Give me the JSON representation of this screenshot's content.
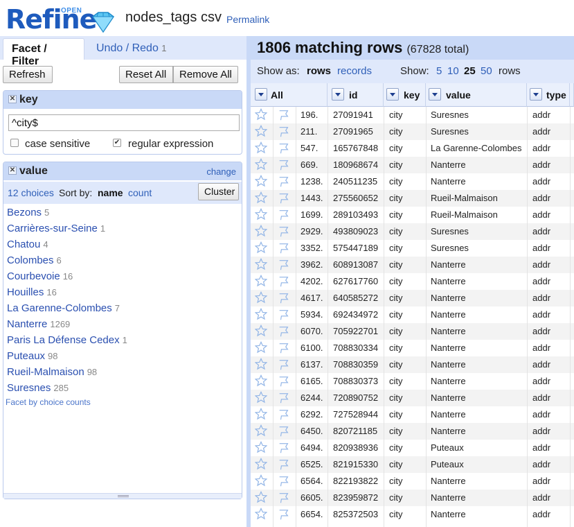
{
  "header": {
    "logo_text": "Refine",
    "logo_badge": "OPEN",
    "project_name": "nodes_tags csv",
    "permalink": "Permalink"
  },
  "left": {
    "tabs": {
      "facet_filter": "Facet / Filter",
      "undo_redo": "Undo / Redo",
      "undo_count": "1"
    },
    "buttons": {
      "refresh": "Refresh",
      "reset_all": "Reset All",
      "remove_all": "Remove All"
    },
    "key_facet": {
      "title": "key",
      "query": "^city$",
      "case_sensitive_label": "case sensitive",
      "case_sensitive": false,
      "regex_label": "regular expression",
      "regex": true
    },
    "value_facet": {
      "title": "value",
      "change": "change",
      "choices_count": "12 choices",
      "sort_by_label": "Sort by:",
      "sort_name": "name",
      "sort_count": "count",
      "cluster": "Cluster",
      "choices": [
        {
          "label": "Bezons",
          "count": "5"
        },
        {
          "label": "Carrières-sur-Seine",
          "count": "1"
        },
        {
          "label": "Chatou",
          "count": "4"
        },
        {
          "label": "Colombes",
          "count": "6"
        },
        {
          "label": "Courbevoie",
          "count": "16"
        },
        {
          "label": "Houilles",
          "count": "16"
        },
        {
          "label": "La Garenne-Colombes",
          "count": "7"
        },
        {
          "label": "Nanterre",
          "count": "1269"
        },
        {
          "label": "Paris La Défense Cedex",
          "count": "1"
        },
        {
          "label": "Puteaux",
          "count": "98"
        },
        {
          "label": "Rueil-Malmaison",
          "count": "98"
        },
        {
          "label": "Suresnes",
          "count": "285"
        }
      ],
      "facet_by_counts": "Facet by choice counts"
    }
  },
  "right": {
    "matching": "1806 matching rows",
    "total": "(67828 total)",
    "show_as_label": "Show as:",
    "show_rows": "rows",
    "show_records": "records",
    "show_label": "Show:",
    "page_sizes": [
      "5",
      "10",
      "25",
      "50"
    ],
    "page_size_selected": "25",
    "rows_word": "rows",
    "columns": [
      "All",
      "id",
      "key",
      "value",
      "type"
    ],
    "rows": [
      {
        "num": "196.",
        "id": "27091941",
        "key": "city",
        "value": "Suresnes",
        "type": "addr"
      },
      {
        "num": "211.",
        "id": "27091965",
        "key": "city",
        "value": "Suresnes",
        "type": "addr"
      },
      {
        "num": "547.",
        "id": "165767848",
        "key": "city",
        "value": "La Garenne-Colombes",
        "type": "addr"
      },
      {
        "num": "669.",
        "id": "180968674",
        "key": "city",
        "value": "Nanterre",
        "type": "addr"
      },
      {
        "num": "1238.",
        "id": "240511235",
        "key": "city",
        "value": "Nanterre",
        "type": "addr"
      },
      {
        "num": "1443.",
        "id": "275560652",
        "key": "city",
        "value": "Rueil-Malmaison",
        "type": "addr"
      },
      {
        "num": "1699.",
        "id": "289103493",
        "key": "city",
        "value": "Rueil-Malmaison",
        "type": "addr"
      },
      {
        "num": "2929.",
        "id": "493809023",
        "key": "city",
        "value": "Suresnes",
        "type": "addr"
      },
      {
        "num": "3352.",
        "id": "575447189",
        "key": "city",
        "value": "Suresnes",
        "type": "addr"
      },
      {
        "num": "3962.",
        "id": "608913087",
        "key": "city",
        "value": "Nanterre",
        "type": "addr"
      },
      {
        "num": "4202.",
        "id": "627617760",
        "key": "city",
        "value": "Nanterre",
        "type": "addr"
      },
      {
        "num": "4617.",
        "id": "640585272",
        "key": "city",
        "value": "Nanterre",
        "type": "addr"
      },
      {
        "num": "5934.",
        "id": "692434972",
        "key": "city",
        "value": "Nanterre",
        "type": "addr"
      },
      {
        "num": "6070.",
        "id": "705922701",
        "key": "city",
        "value": "Nanterre",
        "type": "addr"
      },
      {
        "num": "6100.",
        "id": "708830334",
        "key": "city",
        "value": "Nanterre",
        "type": "addr"
      },
      {
        "num": "6137.",
        "id": "708830359",
        "key": "city",
        "value": "Nanterre",
        "type": "addr"
      },
      {
        "num": "6165.",
        "id": "708830373",
        "key": "city",
        "value": "Nanterre",
        "type": "addr"
      },
      {
        "num": "6244.",
        "id": "720890752",
        "key": "city",
        "value": "Nanterre",
        "type": "addr"
      },
      {
        "num": "6292.",
        "id": "727528944",
        "key": "city",
        "value": "Nanterre",
        "type": "addr"
      },
      {
        "num": "6450.",
        "id": "820721185",
        "key": "city",
        "value": "Nanterre",
        "type": "addr"
      },
      {
        "num": "6494.",
        "id": "820938936",
        "key": "city",
        "value": "Puteaux",
        "type": "addr"
      },
      {
        "num": "6525.",
        "id": "821915330",
        "key": "city",
        "value": "Puteaux",
        "type": "addr"
      },
      {
        "num": "6564.",
        "id": "822193822",
        "key": "city",
        "value": "Nanterre",
        "type": "addr"
      },
      {
        "num": "6605.",
        "id": "823959872",
        "key": "city",
        "value": "Nanterre",
        "type": "addr"
      },
      {
        "num": "6654.",
        "id": "825372503",
        "key": "city",
        "value": "Nanterre",
        "type": "addr"
      }
    ]
  },
  "colors": {
    "brand": "#1e5bbd",
    "link": "#2f5fb8",
    "panel": "#c9d9f7",
    "panel_light": "#dfe8fb"
  }
}
